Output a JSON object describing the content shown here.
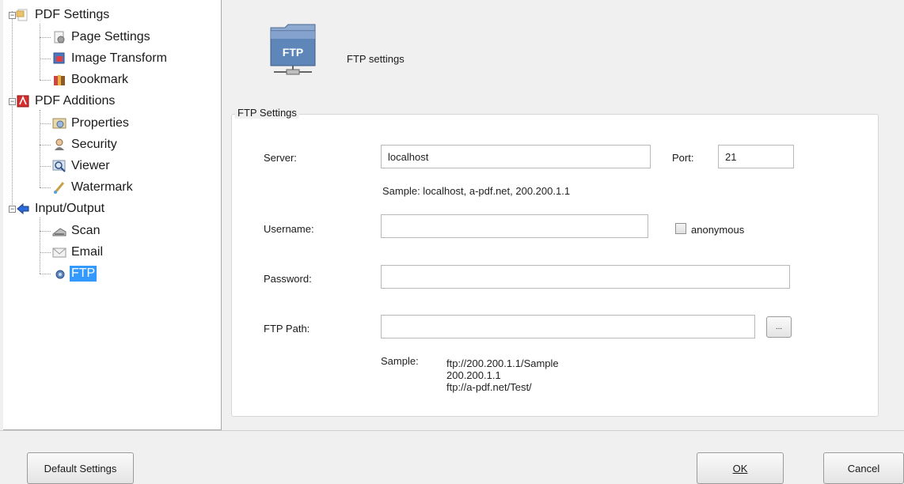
{
  "tree": {
    "groups": [
      {
        "label": "PDF Settings",
        "icon": "pdf-settings-icon",
        "children": [
          {
            "label": "Page Settings",
            "icon": "page-settings-icon"
          },
          {
            "label": "Image Transform",
            "icon": "image-transform-icon"
          },
          {
            "label": "Bookmark",
            "icon": "bookmark-icon"
          }
        ]
      },
      {
        "label": "PDF Additions",
        "icon": "pdf-additions-icon",
        "children": [
          {
            "label": "Properties",
            "icon": "properties-icon"
          },
          {
            "label": "Security",
            "icon": "security-icon"
          },
          {
            "label": "Viewer",
            "icon": "viewer-icon"
          },
          {
            "label": "Watermark",
            "icon": "watermark-icon"
          }
        ]
      },
      {
        "label": "Input/Output",
        "icon": "input-output-icon",
        "children": [
          {
            "label": "Scan",
            "icon": "scan-icon"
          },
          {
            "label": "Email",
            "icon": "email-icon"
          },
          {
            "label": "FTP",
            "icon": "ftp-small-icon",
            "selected": true
          }
        ]
      }
    ]
  },
  "header": {
    "icon_text": "FTP",
    "title": "FTP settings"
  },
  "group": {
    "legend": "FTP Settings",
    "server": {
      "label": "Server:",
      "value": "localhost"
    },
    "port": {
      "label": "Port:",
      "value": "21"
    },
    "server_sample": "Sample: localhost, a-pdf.net, 200.200.1.1",
    "username": {
      "label": "Username:",
      "value": ""
    },
    "anonymous": {
      "label": "anonymous",
      "checked": false
    },
    "password": {
      "label": "Password:",
      "value": ""
    },
    "ftp_path": {
      "label": "FTP Path:",
      "value": "",
      "browse_label": "..."
    },
    "path_sample": {
      "label": "Sample:",
      "lines": [
        "ftp://200.200.1.1/Sample",
        "200.200.1.1",
        "ftp://a-pdf.net/Test/"
      ]
    }
  },
  "footer": {
    "default_label": "Default Settings",
    "ok_label": "OK",
    "cancel_label": "Cancel"
  },
  "colors": {
    "selection": "#3399ff",
    "ftp_folder": "#5f86b8"
  }
}
